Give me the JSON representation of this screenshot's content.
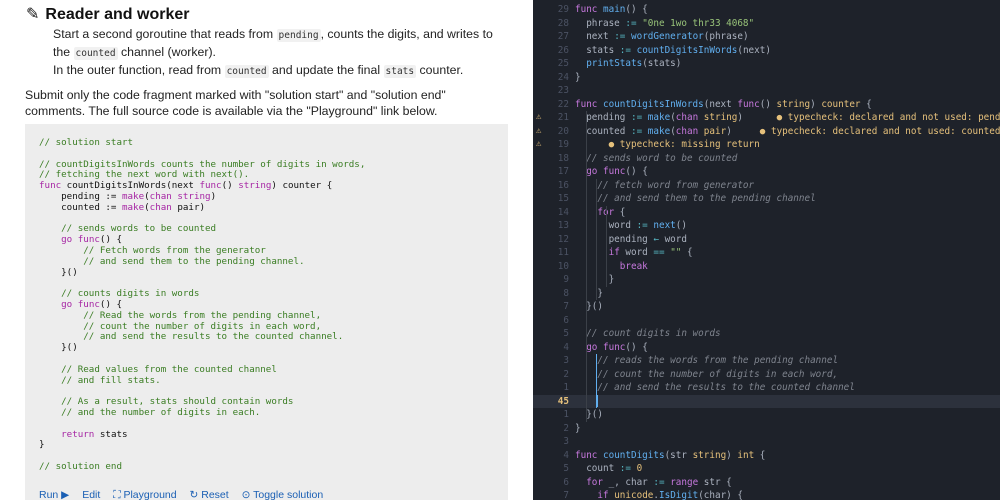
{
  "lesson": {
    "heading": "Reader and worker",
    "step2_text": "Start a second goroutine that reads from pending, counts the digits, and writes to the counted channel (worker).",
    "step3_text": "In the outer function, read from counted and update the final stats counter.",
    "submit_text": "Submit only the code fragment marked with \"solution start\" and \"solution end\" comments. The full source code is available via the \"Playground\" link below."
  },
  "template_code": [
    "// solution start",
    "",
    "// countDigitsInWords counts the number of digits in words,",
    "// fetching the next word with next().",
    "func countDigitsInWords(next func() string) counter {",
    "    pending := make(chan string)",
    "    counted := make(chan pair)",
    "",
    "    // sends words to be counted",
    "    go func() {",
    "        // Fetch words from the generator",
    "        // and send them to the pending channel.",
    "    }()",
    "",
    "    // counts digits in words",
    "    go func() {",
    "        // Read the words from the pending channel,",
    "        // count the number of digits in each word,",
    "        // and send the results to the counted channel.",
    "    }()",
    "",
    "    // Read values from the counted channel",
    "    // and fill stats.",
    "",
    "    // As a result, stats should contain words",
    "    // and the number of digits in each.",
    "",
    "    return stats",
    "}",
    "",
    "// solution end"
  ],
  "toolbar": {
    "run": "Run ▶",
    "edit": "Edit",
    "playground": "⛶ Playground",
    "reset": "↻ Reset",
    "toggle": "⊙ Toggle solution"
  },
  "editor": {
    "lines": [
      {
        "n": "29",
        "warn": false,
        "cur": false,
        "html": "<span class='ek'>func</span> <span class='ef'>main</span>() {"
      },
      {
        "n": "28",
        "warn": false,
        "cur": false,
        "html": "  phrase <span class='eo'>:=</span> <span class='es'>\"0ne 1wo thr33 4068\"</span>"
      },
      {
        "n": "27",
        "warn": false,
        "cur": false,
        "html": "  next <span class='eo'>:=</span> <span class='ef'>wordGenerator</span>(phrase)"
      },
      {
        "n": "26",
        "warn": false,
        "cur": false,
        "html": "  stats <span class='eo'>:=</span> <span class='ef'>countDigitsInWords</span>(next)"
      },
      {
        "n": "25",
        "warn": false,
        "cur": false,
        "html": "  <span class='ef'>printStats</span>(stats)"
      },
      {
        "n": "24",
        "warn": false,
        "cur": false,
        "html": "}"
      },
      {
        "n": "23",
        "warn": false,
        "cur": false,
        "html": ""
      },
      {
        "n": "22",
        "warn": false,
        "cur": false,
        "html": "<span class='ek'>func</span> <span class='ef'>countDigitsInWords</span>(next <span class='ek'>func</span>() <span class='et'>string</span>) <span class='et'>counter</span> {"
      },
      {
        "n": "21",
        "warn": true,
        "cur": false,
        "html": "  pending <span class='eo'>:=</span> <span class='ef'>make</span>(<span class='ek'>chan</span> <span class='et'>string</span>)      <span class='diag'>● typecheck: declared and not used: pending</span>"
      },
      {
        "n": "20",
        "warn": true,
        "cur": false,
        "html": "  counted <span class='eo'>:=</span> <span class='ef'>make</span>(<span class='ek'>chan</span> <span class='et'>pair</span>)     <span class='diag'>● typecheck: declared and not used: counted</span>"
      },
      {
        "n": "19",
        "warn": true,
        "cur": false,
        "html": "      <span class='diag'>● typecheck: missing return</span>"
      },
      {
        "n": "18",
        "warn": false,
        "cur": false,
        "html": "  <span class='ec'>// sends word to be counted</span>"
      },
      {
        "n": "17",
        "warn": false,
        "cur": false,
        "html": "  <span class='ek'>go</span> <span class='ek'>func</span>() {"
      },
      {
        "n": "16",
        "warn": false,
        "cur": false,
        "html": "    <span class='ec'>// fetch word from generator</span>"
      },
      {
        "n": "15",
        "warn": false,
        "cur": false,
        "html": "    <span class='ec'>// and send them to the pending channel</span>"
      },
      {
        "n": "14",
        "warn": false,
        "cur": false,
        "html": "    <span class='ek'>for</span> {"
      },
      {
        "n": "13",
        "warn": false,
        "cur": false,
        "html": "      word <span class='eo'>:=</span> <span class='ef'>next</span>()"
      },
      {
        "n": "12",
        "warn": false,
        "cur": false,
        "html": "      pending <span class='eo'>←</span> word"
      },
      {
        "n": "11",
        "warn": false,
        "cur": false,
        "html": "      <span class='ek'>if</span> word <span class='eo'>==</span> <span class='es'>\"\"</span> {"
      },
      {
        "n": "10",
        "warn": false,
        "cur": false,
        "html": "        <span class='ek'>break</span>"
      },
      {
        "n": "9",
        "warn": false,
        "cur": false,
        "html": "      }"
      },
      {
        "n": "8",
        "warn": false,
        "cur": false,
        "html": "    }"
      },
      {
        "n": "7",
        "warn": false,
        "cur": false,
        "html": "  }()"
      },
      {
        "n": "6",
        "warn": false,
        "cur": false,
        "html": ""
      },
      {
        "n": "5",
        "warn": false,
        "cur": false,
        "html": "  <span class='ec'>// count digits in words</span>"
      },
      {
        "n": "4",
        "warn": false,
        "cur": false,
        "html": "  <span class='ek'>go</span> <span class='ek'>func</span>() {"
      },
      {
        "n": "3",
        "warn": false,
        "cur": false,
        "html": "    <span class='ec'>// reads the words from the pending channel</span>"
      },
      {
        "n": "2",
        "warn": false,
        "cur": false,
        "html": "    <span class='ec'>// count the number of digits in each word,</span>"
      },
      {
        "n": "1",
        "warn": false,
        "cur": false,
        "html": "    <span class='ec'>// and send the results to the counted channel</span>"
      },
      {
        "n": "45",
        "warn": false,
        "cur": true,
        "html": ""
      },
      {
        "n": "1",
        "warn": false,
        "cur": false,
        "html": "  }()"
      },
      {
        "n": "2",
        "warn": false,
        "cur": false,
        "html": "}"
      },
      {
        "n": "3",
        "warn": false,
        "cur": false,
        "html": ""
      },
      {
        "n": "4",
        "warn": false,
        "cur": false,
        "html": "<span class='ek'>func</span> <span class='ef'>countDigits</span>(str <span class='et'>string</span>) <span class='et'>int</span> {"
      },
      {
        "n": "5",
        "warn": false,
        "cur": false,
        "html": "  count <span class='eo'>:=</span> <span class='et'>0</span>"
      },
      {
        "n": "6",
        "warn": false,
        "cur": false,
        "html": "  <span class='ek'>for</span> _, char <span class='eo'>:=</span> <span class='ek'>range</span> str {"
      },
      {
        "n": "7",
        "warn": false,
        "cur": false,
        "html": "    <span class='ek'>if</span> <span class='et'>unicode</span>.<span class='ef'>IsDigit</span>(char) {"
      }
    ]
  }
}
